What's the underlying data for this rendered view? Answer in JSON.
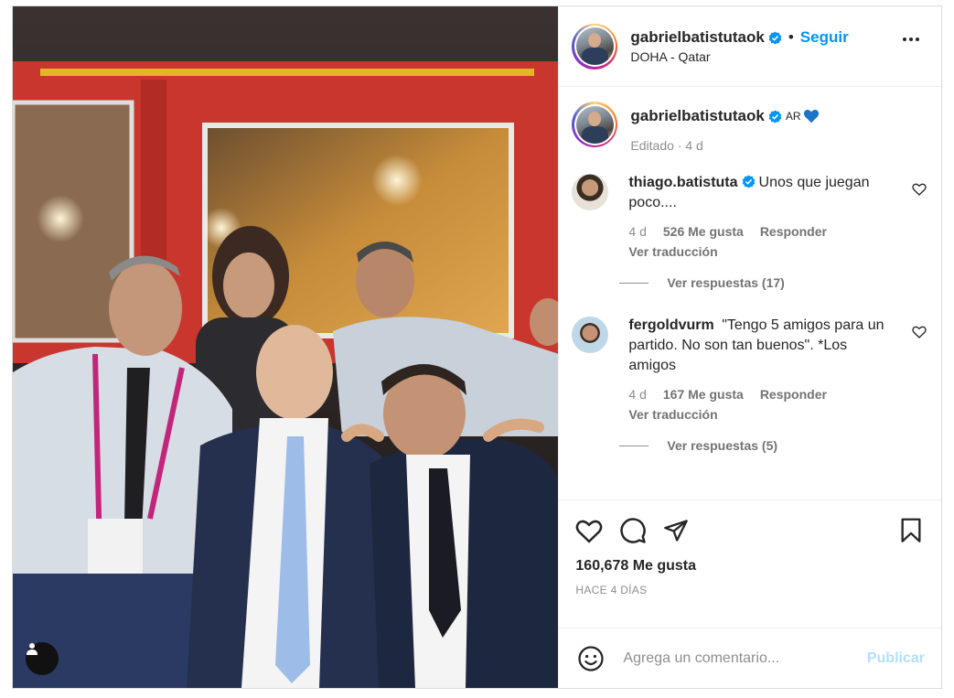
{
  "post": {
    "username": "gabrielbatistutaok",
    "follow_label": "Seguir",
    "separator": "•",
    "location": "DOHA - Qatar",
    "caption_text": "AR",
    "caption_meta": "Editado · 4 d",
    "likes": "160,678 Me gusta",
    "time_ago": "HACE 4 DÍAS"
  },
  "comments": [
    {
      "username": "thiago.batistuta",
      "text": "Unos que juegan poco....",
      "time": "4 d",
      "likes": "526 Me gusta",
      "reply_label": "Responder",
      "translate_label": "Ver traducción",
      "view_replies": "Ver respuestas (17)"
    },
    {
      "username": "fergoldvurm",
      "text": "\"Tengo 5 amigos para un partido. No son tan buenos\". *Los amigos",
      "time": "4 d",
      "likes": "167 Me gusta",
      "reply_label": "Responder",
      "translate_label": "Ver traducción",
      "view_replies": "Ver respuestas (5)"
    }
  ],
  "add_comment": {
    "placeholder": "Agrega un comentario...",
    "publish_label": "Publicar"
  },
  "icons": {
    "verified": "verified-badge-icon",
    "more": "more-options-icon",
    "like": "heart-icon",
    "comment": "comment-icon",
    "share": "paper-plane-icon",
    "save": "bookmark-icon",
    "emoji": "emoji-icon",
    "tag": "user-tag-icon"
  },
  "colors": {
    "accent": "#0095f6",
    "publish_disabled": "#b2dffc",
    "text": "#262626",
    "muted": "#8e8e8e"
  }
}
